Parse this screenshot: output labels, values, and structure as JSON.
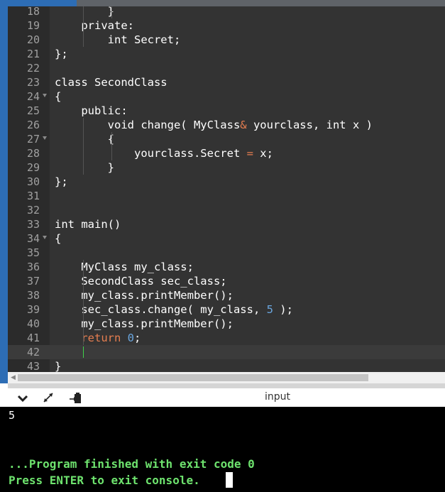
{
  "editor": {
    "lines": [
      {
        "n": "18",
        "code": "        }",
        "fold": false
      },
      {
        "n": "19",
        "code": "    private:",
        "fold": false
      },
      {
        "n": "20",
        "code": "        int Secret;",
        "fold": false
      },
      {
        "n": "21",
        "code": "};",
        "fold": false
      },
      {
        "n": "22",
        "code": "",
        "fold": false
      },
      {
        "n": "23",
        "code": "class SecondClass",
        "fold": false
      },
      {
        "n": "24",
        "code": "{",
        "fold": true
      },
      {
        "n": "25",
        "code": "    public:",
        "fold": false
      },
      {
        "n": "26",
        "code": "        void change( MyClass& yourclass, int x )",
        "fold": false
      },
      {
        "n": "27",
        "code": "        {",
        "fold": true
      },
      {
        "n": "28",
        "code": "            yourclass.Secret = x;",
        "fold": false
      },
      {
        "n": "29",
        "code": "        }",
        "fold": false
      },
      {
        "n": "30",
        "code": "};",
        "fold": false
      },
      {
        "n": "31",
        "code": "",
        "fold": false
      },
      {
        "n": "32",
        "code": "",
        "fold": false
      },
      {
        "n": "33",
        "code": "int main()",
        "fold": false
      },
      {
        "n": "34",
        "code": "{",
        "fold": true
      },
      {
        "n": "35",
        "code": "",
        "fold": false
      },
      {
        "n": "36",
        "code": "    MyClass my_class;",
        "fold": false
      },
      {
        "n": "37",
        "code": "    SecondClass sec_class;",
        "fold": false
      },
      {
        "n": "38",
        "code": "    my_class.printMember();",
        "fold": false
      },
      {
        "n": "39",
        "code": "    sec_class.change( my_class, 5 );",
        "fold": false
      },
      {
        "n": "40",
        "code": "    my_class.printMember();",
        "fold": false
      },
      {
        "n": "41",
        "code": "    return 0;",
        "fold": false
      },
      {
        "n": "42",
        "code": "",
        "fold": false
      },
      {
        "n": "43",
        "code": "}",
        "fold": false
      }
    ],
    "active_line": "42"
  },
  "io": {
    "title": "input",
    "icons": [
      "chevron-down-icon",
      "expand-arrows-icon",
      "clipboard-copy-icon"
    ]
  },
  "console": {
    "output": "5",
    "finished": "...Program finished with exit code 0",
    "press": "Press ENTER to exit console."
  },
  "colors": {
    "editor_bg": "#333333",
    "gutter_bg": "#2b2b2b",
    "keyword_return": "#e67e50",
    "number": "#6aa6df",
    "console_text": "#6ee36e",
    "accent": "#2d6db5"
  }
}
